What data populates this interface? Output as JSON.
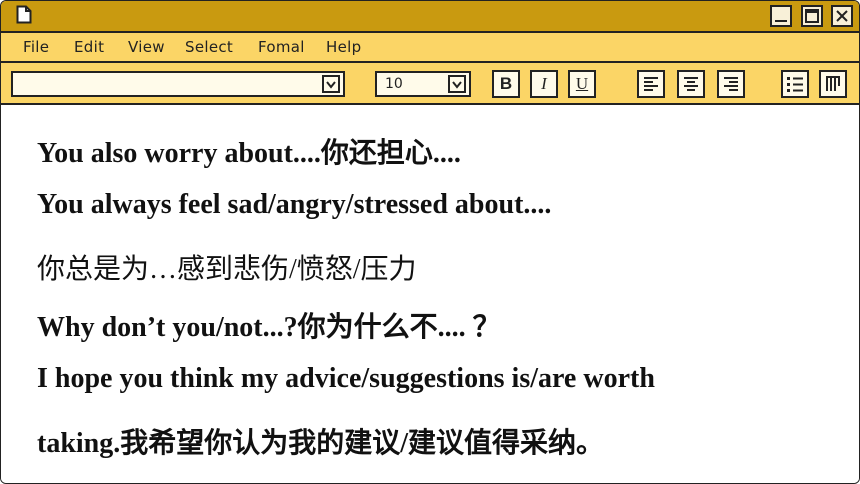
{
  "menu": {
    "items": [
      "File",
      "Edit",
      "View",
      "Select",
      "Fomal",
      "Help"
    ]
  },
  "toolbar": {
    "font_value": "",
    "size_value": "10",
    "bold_label": "B",
    "italic_label": "I",
    "underline_label": "U",
    "icons": [
      "align-left-icon",
      "align-center-icon",
      "align-right-icon",
      "bullet-list-icon",
      "columns-icon"
    ]
  },
  "content": {
    "lines": [
      "You also worry about....你还担心....",
      "You always feel sad/angry/stressed about....",
      "你总是为…感到悲伤/愤怒/压力",
      "Why don’t you/not...?你为什么不.... ？",
      "I hope you think my advice/suggestions is/are worth",
      "taking.我希望你认为我的建议/建议值得采纳。"
    ]
  },
  "colors": {
    "titlebar": "#c99a10",
    "menubar": "#fbd566",
    "content_bg": "#ffffff",
    "frame": "#222222"
  }
}
